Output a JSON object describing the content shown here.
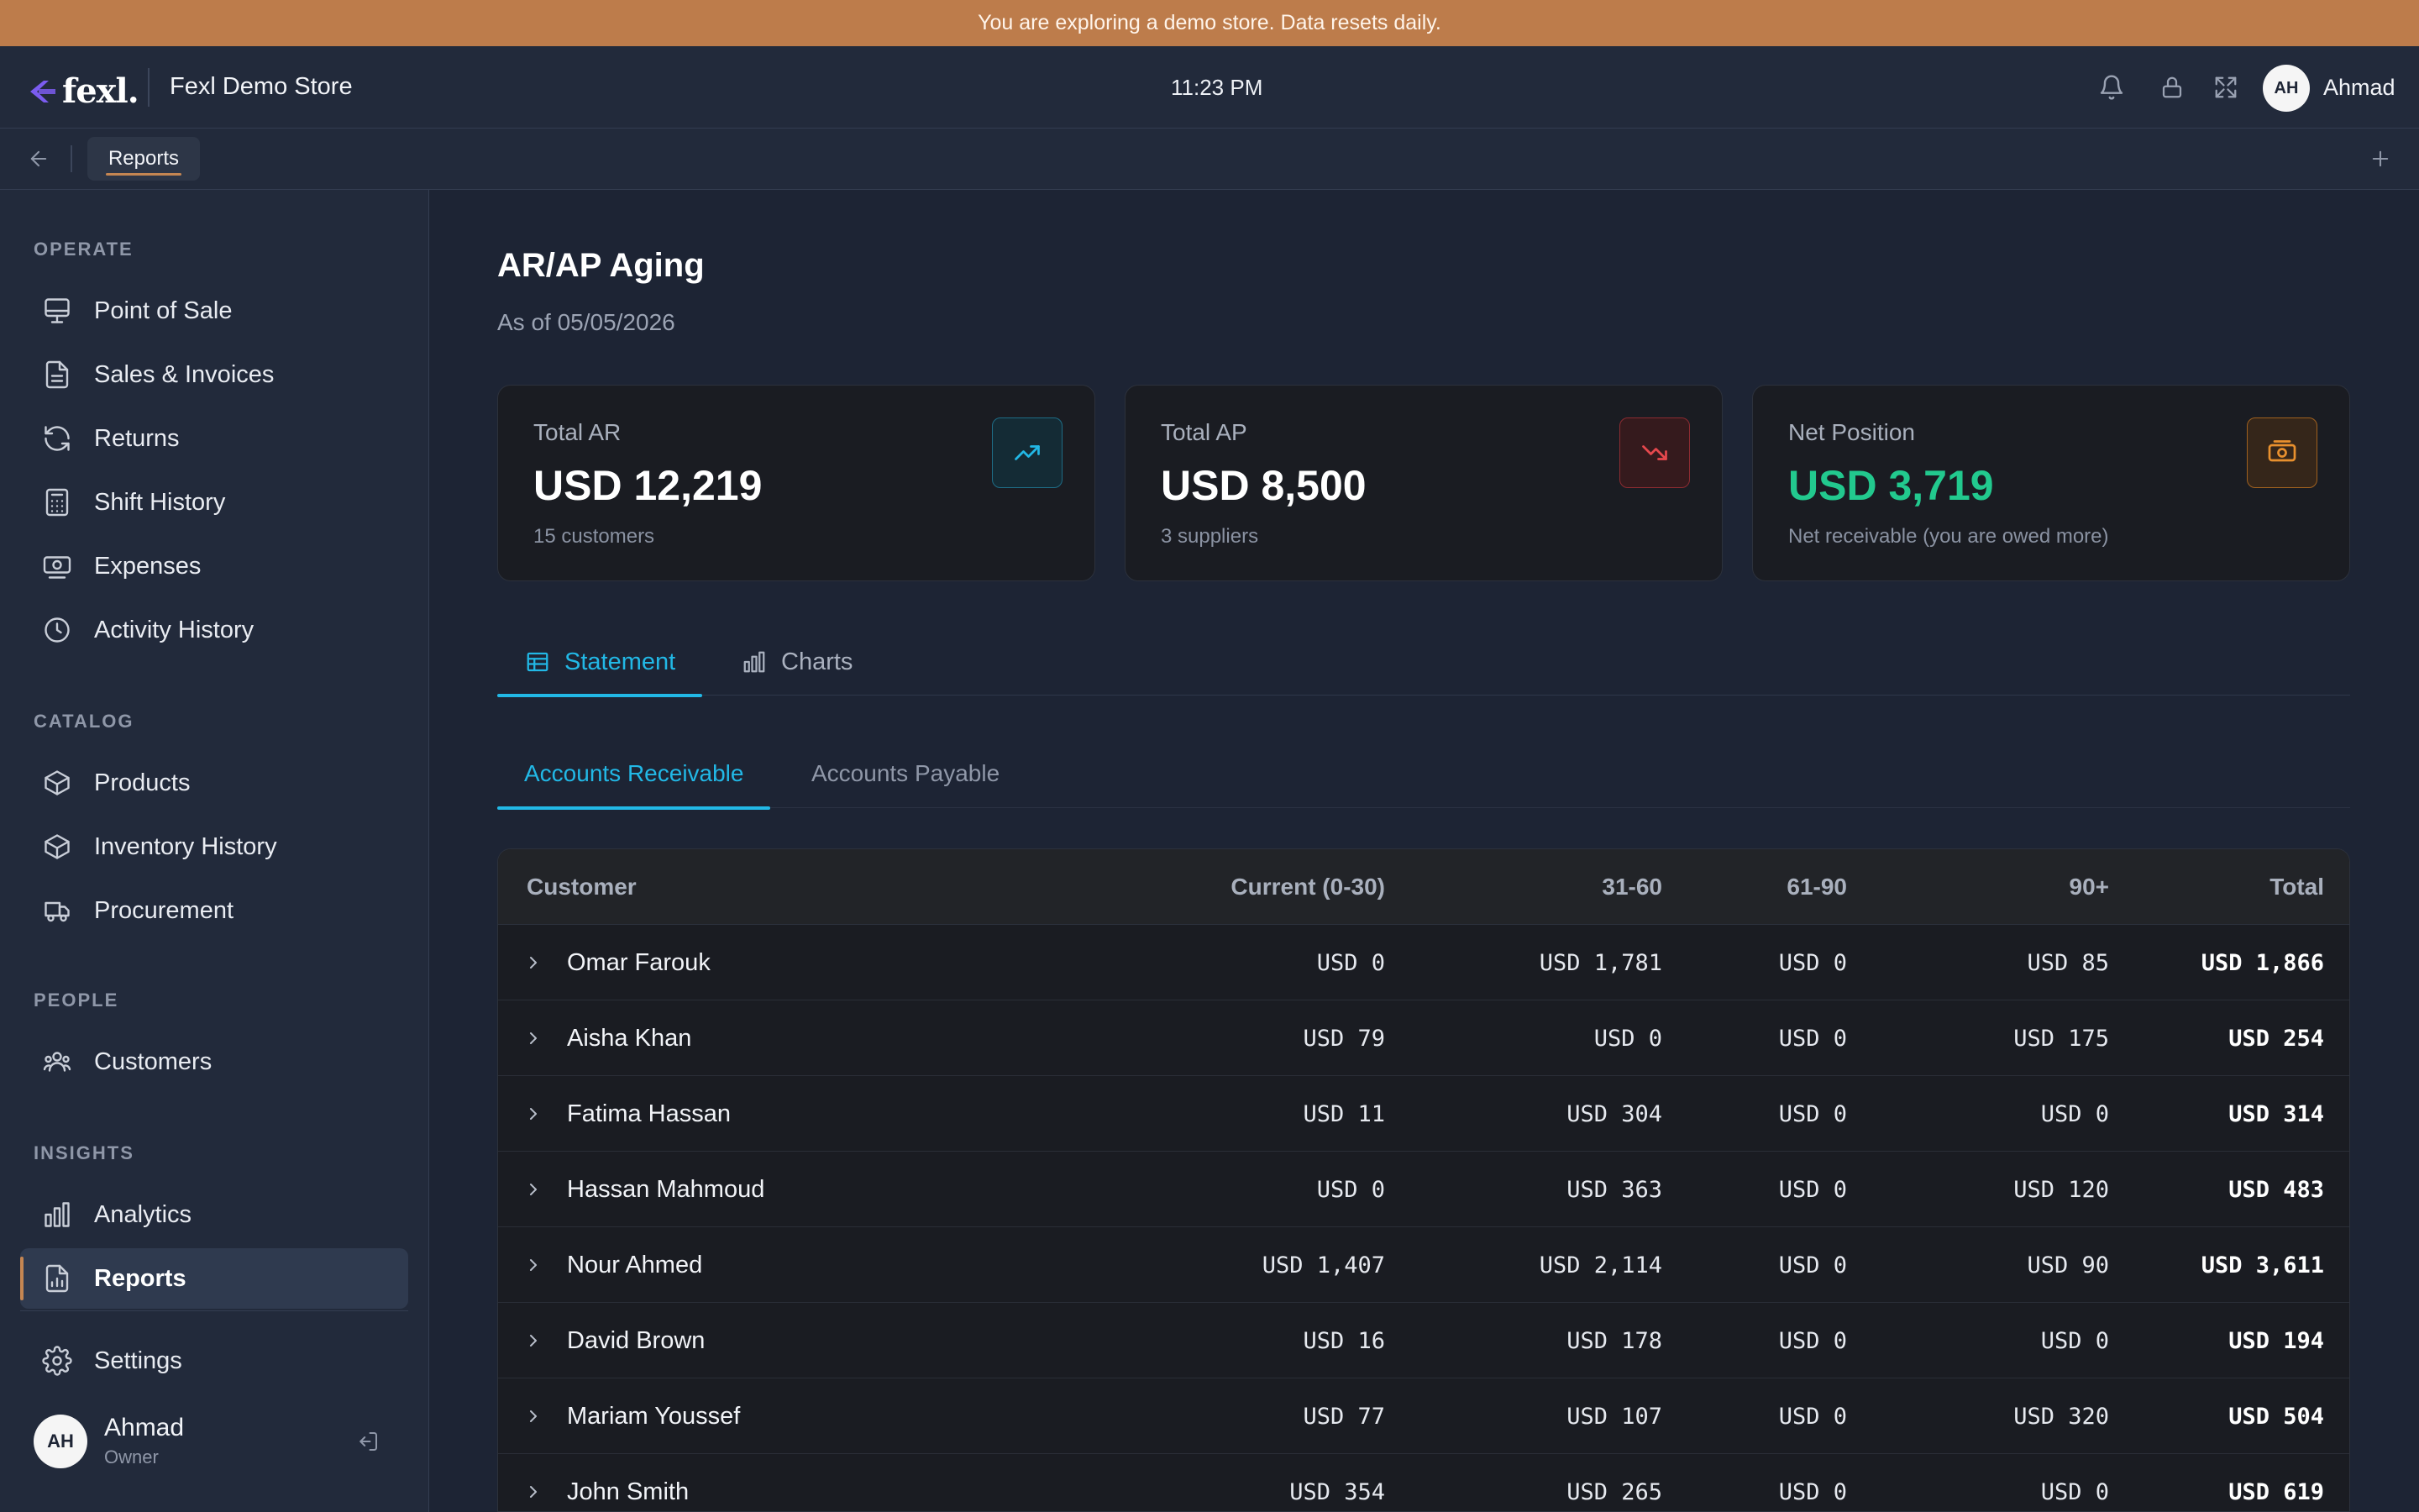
{
  "banner": {
    "text": "You are exploring a demo store. Data resets daily."
  },
  "topbar": {
    "logo": "fexl.",
    "store_name": "Fexl Demo Store",
    "time": "11:23 PM",
    "user_initials": "AH",
    "user_name": "Ahmad"
  },
  "tabbar": {
    "tabs": [
      {
        "label": "Reports"
      }
    ]
  },
  "sidebar": {
    "sections": [
      {
        "title": "OPERATE",
        "items": [
          {
            "label": "Point of Sale",
            "icon": "monitor-icon"
          },
          {
            "label": "Sales & Invoices",
            "icon": "document-icon"
          },
          {
            "label": "Returns",
            "icon": "refresh-icon"
          },
          {
            "label": "Shift History",
            "icon": "calculator-icon"
          },
          {
            "label": "Expenses",
            "icon": "cash-icon"
          },
          {
            "label": "Activity History",
            "icon": "clock-icon"
          }
        ]
      },
      {
        "title": "CATALOG",
        "items": [
          {
            "label": "Products",
            "icon": "box-icon"
          },
          {
            "label": "Inventory History",
            "icon": "box-icon"
          },
          {
            "label": "Procurement",
            "icon": "truck-icon"
          }
        ]
      },
      {
        "title": "PEOPLE",
        "items": [
          {
            "label": "Customers",
            "icon": "users-icon"
          }
        ]
      },
      {
        "title": "INSIGHTS",
        "items": [
          {
            "label": "Analytics",
            "icon": "bar-chart-icon"
          },
          {
            "label": "Reports",
            "icon": "report-icon",
            "active": true
          }
        ]
      }
    ],
    "settings_label": "Settings",
    "user": {
      "initials": "AH",
      "name": "Ahmad",
      "role": "Owner"
    }
  },
  "page": {
    "title": "AR/AP Aging",
    "subtitle": "As of 05/05/2026"
  },
  "cards": [
    {
      "label": "Total AR",
      "value": "USD 12,219",
      "note": "15 customers",
      "icon": "trending-up-icon",
      "accent": "#22b8e6"
    },
    {
      "label": "Total AP",
      "value": "USD 8,500",
      "note": "3 suppliers",
      "icon": "trending-down-icon",
      "accent": "#e5484d"
    },
    {
      "label": "Net Position",
      "value": "USD 3,719",
      "note": "Net receivable (you are owed more)",
      "icon": "money-icon",
      "accent": "#e8902e",
      "value_color": "#22c98e"
    }
  ],
  "tabs": [
    {
      "label": "Statement",
      "active": true
    },
    {
      "label": "Charts",
      "active": false
    }
  ],
  "subtabs": [
    {
      "label": "Accounts Receivable",
      "active": true
    },
    {
      "label": "Accounts Payable",
      "active": false
    }
  ],
  "table": {
    "columns": [
      "Customer",
      "Current (0-30)",
      "31-60",
      "61-90",
      "90+",
      "Total"
    ],
    "rows": [
      [
        "Omar Farouk",
        "USD 0",
        "USD 1,781",
        "USD 0",
        "USD 85",
        "USD 1,866"
      ],
      [
        "Aisha Khan",
        "USD 79",
        "USD 0",
        "USD 0",
        "USD 175",
        "USD 254"
      ],
      [
        "Fatima Hassan",
        "USD 11",
        "USD 304",
        "USD 0",
        "USD 0",
        "USD 314"
      ],
      [
        "Hassan Mahmoud",
        "USD 0",
        "USD 363",
        "USD 0",
        "USD 120",
        "USD 483"
      ],
      [
        "Nour Ahmed",
        "USD 1,407",
        "USD 2,114",
        "USD 0",
        "USD 90",
        "USD 3,611"
      ],
      [
        "David Brown",
        "USD 16",
        "USD 178",
        "USD 0",
        "USD 0",
        "USD 194"
      ],
      [
        "Mariam Youssef",
        "USD 77",
        "USD 107",
        "USD 0",
        "USD 320",
        "USD 504"
      ],
      [
        "John Smith",
        "USD 354",
        "USD 265",
        "USD 0",
        "USD 0",
        "USD 619"
      ]
    ]
  },
  "colors": {
    "banner": "#bd7c4b",
    "accent": "#22b8e6",
    "positive": "#22c98e",
    "active_indicator": "#c58652"
  }
}
